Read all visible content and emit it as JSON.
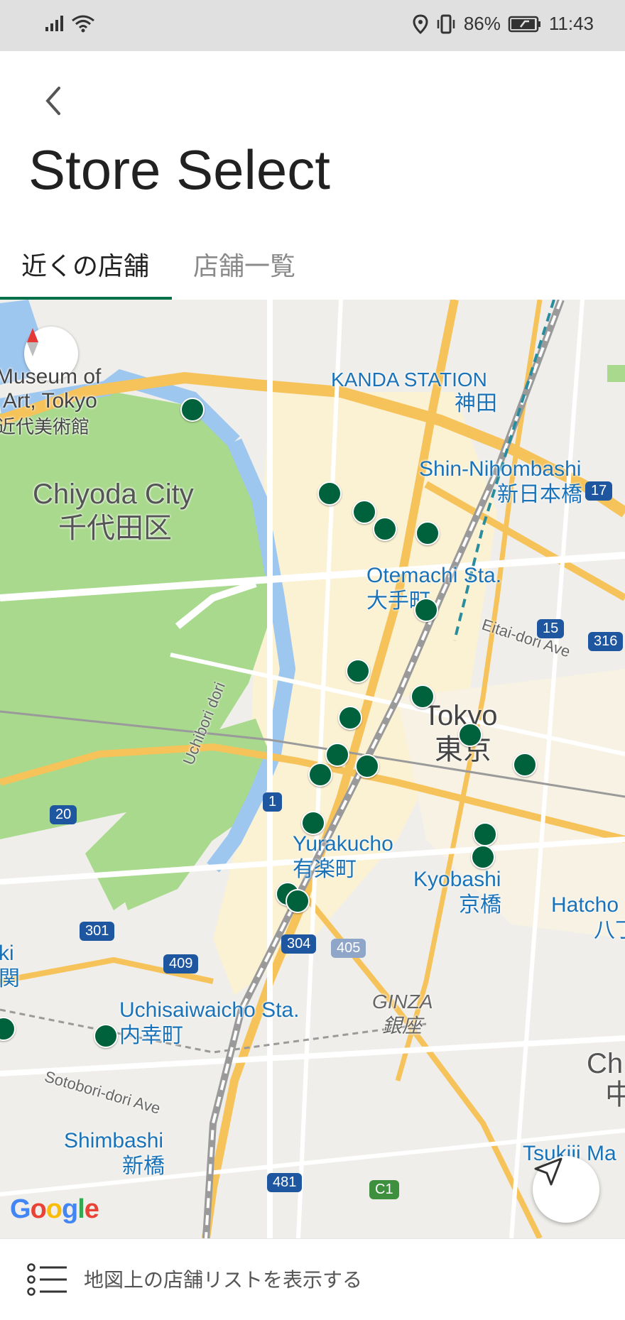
{
  "status": {
    "battery_percent": "86%",
    "time": "11:43"
  },
  "header": {
    "title": "Store Select",
    "tabs": [
      {
        "label": "近くの店舗",
        "active": true
      },
      {
        "label": "店舗一覧",
        "active": false
      }
    ],
    "accent_color": "#00704a"
  },
  "map": {
    "labels": {
      "museum_en1": "Museum of",
      "museum_en2": "Art, Tokyo",
      "museum_ja": "近代美術館",
      "chiyoda_en": "Chiyoda City",
      "chiyoda_ja": "千代田区",
      "kanda_en": "KANDA STATION",
      "kanda_ja": "神田",
      "shin_nihombashi_en": "Shin-Nihombashi",
      "shin_nihombashi_ja": "新日本橋",
      "otemachi_en": "Otemachi Sta.",
      "otemachi_ja": "大手町",
      "eitai": "Eitai-dori Ave",
      "uchibori": "Uchibori dori",
      "tokyo_en": "Tokyo",
      "tokyo_ja": "東京",
      "yurakucho_en": "Yurakucho",
      "yurakucho_ja": "有楽町",
      "kyobashi_en": "Kyobashi",
      "kyobashi_ja": "京橋",
      "hatcho_en": "Hatcho",
      "hatcho_ja": "八丁",
      "ginza_en": "GINZA",
      "ginza_ja": "銀座",
      "uchisaiwaicho_en": "Uchisaiwaicho Sta.",
      "uchisaiwaicho_ja": "内幸町",
      "sotobori": "Sotobori-dori Ave",
      "shimbashi_en": "Shimbashi",
      "shimbashi_ja": "新橋",
      "tsukiji_en": "Tsukiji Ma",
      "ch_partial": "Ch",
      "naka_partial": "中",
      "ki_partial": "ki",
      "seki_partial": "関"
    },
    "route_shields": [
      "17",
      "15",
      "316",
      "20",
      "1",
      "301",
      "409",
      "304",
      "405",
      "481",
      "C1"
    ],
    "store_count": 23,
    "pin_color": "#00623d",
    "google": "Google"
  },
  "bottom": {
    "label": "地図上の店舗リストを表示する"
  }
}
